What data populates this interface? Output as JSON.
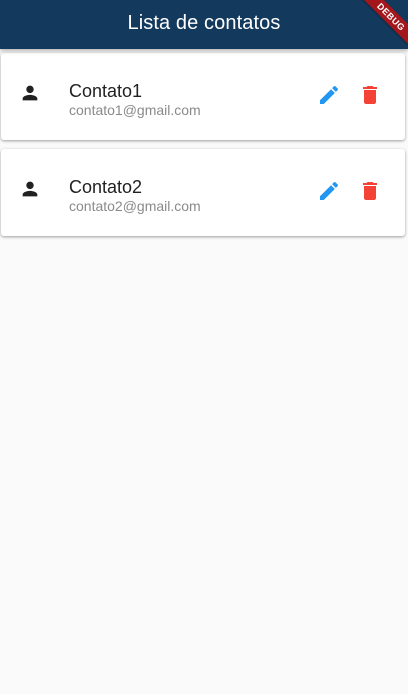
{
  "app_bar": {
    "title": "Lista de contatos",
    "background_color": "#13395d"
  },
  "debug_banner": {
    "label": "DEBUG",
    "color": "#a3171c"
  },
  "contacts": [
    {
      "icon": "person-icon",
      "name": "Contato1",
      "email": "contato1@gmail.com",
      "edit_icon": "edit-icon",
      "delete_icon": "trash-icon"
    },
    {
      "icon": "person-icon",
      "name": "Contato2",
      "email": "contato2@gmail.com",
      "edit_icon": "edit-icon",
      "delete_icon": "trash-icon"
    }
  ],
  "colors": {
    "edit": "#2196f3",
    "delete": "#f44336",
    "background": "#fafafa"
  }
}
